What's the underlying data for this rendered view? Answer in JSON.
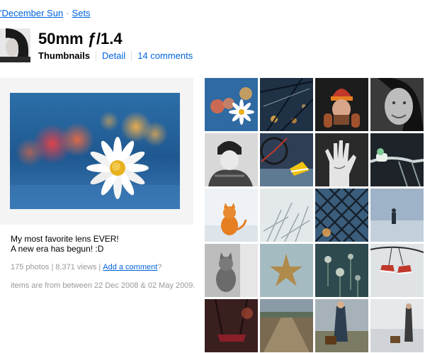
{
  "breadcrumb": {
    "user": "'December Sun",
    "separator": "·",
    "sets": "Sets"
  },
  "set": {
    "title": "50mm ƒ/1.4"
  },
  "subnav": {
    "thumbnails": "Thumbnails",
    "detail": "Detail",
    "comments": "14 comments"
  },
  "description": {
    "line1": "My most favorite lens EVER!",
    "line2": "A new era has begun! :D"
  },
  "stats": {
    "photos": "175 photos",
    "views": "8,371 views",
    "separator": "|",
    "add_comment": "Add a comment",
    "question": "?"
  },
  "date_range": "items are from between 22 Dec 2008 & 02 May 2009.",
  "thumbnails": [
    {
      "icon": "daisy-bokeh-photo"
    },
    {
      "icon": "branches-lights-photo"
    },
    {
      "icon": "beanie-portrait-photo"
    },
    {
      "icon": "smiling-woman-photo"
    },
    {
      "icon": "bw-portrait-photo"
    },
    {
      "icon": "bicycle-sneakers-photo"
    },
    {
      "icon": "hand-writing-photo"
    },
    {
      "icon": "bike-handlebar-photo"
    },
    {
      "icon": "orange-cat-snow-photo"
    },
    {
      "icon": "frosty-grass-photo"
    },
    {
      "icon": "chain-fence-photo"
    },
    {
      "icon": "figure-fog-photo"
    },
    {
      "icon": "tabby-cat-window-photo"
    },
    {
      "icon": "starfish-photo"
    },
    {
      "icon": "dandelion-seeds-photo"
    },
    {
      "icon": "hanging-shoes-photo"
    },
    {
      "icon": "swing-chains-photo"
    },
    {
      "icon": "country-road-photo"
    },
    {
      "icon": "woman-suitcase-photo"
    },
    {
      "icon": "winter-suitcase-photo"
    }
  ]
}
